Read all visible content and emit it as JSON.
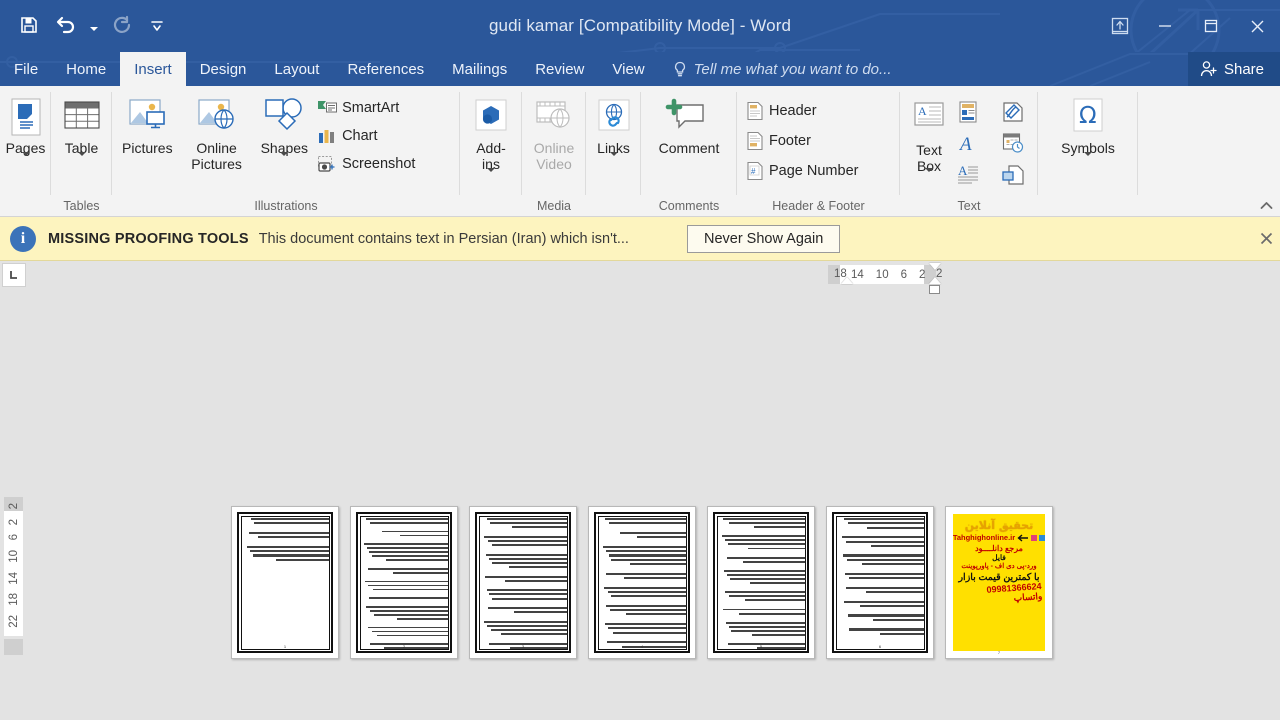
{
  "window": {
    "title": "gudi kamar [Compatibility Mode] - Word",
    "quick_access": [
      {
        "name": "save-button",
        "label": "Save",
        "icon": "save-icon",
        "enabled": true
      },
      {
        "name": "undo-button",
        "label": "Undo",
        "icon": "undo-icon",
        "enabled": true,
        "has_dropdown": true
      },
      {
        "name": "redo-button",
        "label": "Redo",
        "icon": "redo-icon",
        "enabled": false
      },
      {
        "name": "customize-quick-access-toolbar",
        "label": "Customize Quick Access Toolbar",
        "icon": "chevron-down-icon",
        "enabled": true
      }
    ],
    "controls": [
      {
        "name": "ribbon-display-options",
        "label": "Ribbon Display Options",
        "icon": "ribbon-display-icon"
      },
      {
        "name": "minimize-button",
        "label": "Minimize",
        "icon": "minimize-icon"
      },
      {
        "name": "restore-button",
        "label": "Restore Down",
        "icon": "restore-icon"
      },
      {
        "name": "close-button",
        "label": "Close",
        "icon": "close-icon"
      }
    ],
    "accent_color": "#2b579a",
    "tab_active_bg": "#f3f3f3"
  },
  "tabs": [
    {
      "label": "File",
      "active": false
    },
    {
      "label": "Home",
      "active": false
    },
    {
      "label": "Insert",
      "active": true
    },
    {
      "label": "Design",
      "active": false
    },
    {
      "label": "Layout",
      "active": false
    },
    {
      "label": "References",
      "active": false
    },
    {
      "label": "Mailings",
      "active": false
    },
    {
      "label": "Review",
      "active": false
    },
    {
      "label": "View",
      "active": false
    }
  ],
  "tellme": {
    "label": "Tell me what you want to do...",
    "icon": "lightbulb-icon"
  },
  "share": {
    "label": "Share",
    "icon": "share-person-icon"
  },
  "ribbon": {
    "collapse": {
      "name": "collapse-ribbon-button",
      "icon": "chevron-up-icon"
    },
    "groups": [
      {
        "label": "",
        "name": "pages-group",
        "big": [
          {
            "label": "Pages",
            "icon": "pages-icon",
            "dropdown": true,
            "enabled": true
          }
        ]
      },
      {
        "label": "Tables",
        "name": "tables-group",
        "big": [
          {
            "label": "Table",
            "icon": "table-icon",
            "dropdown": true,
            "enabled": true
          }
        ]
      },
      {
        "label": "Illustrations",
        "name": "illustrations-group",
        "big": [
          {
            "label": "Pictures",
            "icon": "pictures-icon",
            "dropdown": false,
            "enabled": true
          },
          {
            "label": "Online Pictures",
            "icon": "online-pictures-icon",
            "dropdown": false,
            "enabled": true
          },
          {
            "label": "Shapes",
            "icon": "shapes-icon",
            "dropdown": true,
            "enabled": true
          }
        ],
        "small": [
          {
            "label": "SmartArt",
            "icon": "smartart-icon",
            "dropdown": false
          },
          {
            "label": "Chart",
            "icon": "chart-icon",
            "dropdown": false
          },
          {
            "label": "Screenshot",
            "icon": "screenshot-icon",
            "dropdown": true
          }
        ]
      },
      {
        "label": "",
        "name": "addins-group",
        "big": [
          {
            "label": "Add-ins",
            "icon": "addins-icon",
            "dropdown": true,
            "enabled": true
          }
        ]
      },
      {
        "label": "Media",
        "name": "media-group",
        "big": [
          {
            "label": "Online Video",
            "icon": "online-video-icon",
            "dropdown": false,
            "enabled": false
          }
        ]
      },
      {
        "label": "",
        "name": "links-group",
        "big": [
          {
            "label": "Links",
            "icon": "links-icon",
            "dropdown": true,
            "enabled": true
          }
        ]
      },
      {
        "label": "Comments",
        "name": "comments-group",
        "big": [
          {
            "label": "Comment",
            "icon": "comment-icon",
            "dropdown": false,
            "enabled": true
          }
        ]
      },
      {
        "label": "Header & Footer",
        "name": "header-footer-group",
        "small": [
          {
            "label": "Header",
            "icon": "header-icon",
            "dropdown": true
          },
          {
            "label": "Footer",
            "icon": "footer-icon",
            "dropdown": true
          },
          {
            "label": "Page Number",
            "icon": "page-number-icon",
            "dropdown": true
          }
        ]
      },
      {
        "label": "Text",
        "name": "text-group",
        "big": [
          {
            "label": "Text Box",
            "icon": "text-box-icon",
            "dropdown": true,
            "enabled": true
          }
        ],
        "mini": [
          {
            "name": "quick-parts-icon",
            "dropdown": true
          },
          {
            "name": "signature-line-icon",
            "dropdown": true
          },
          {
            "name": "wordart-icon",
            "dropdown": true
          },
          {
            "name": "date-time-icon",
            "dropdown": false
          },
          {
            "name": "drop-cap-icon",
            "dropdown": true
          },
          {
            "name": "object-icon",
            "dropdown": true
          }
        ]
      },
      {
        "label": "",
        "name": "symbols-group",
        "big": [
          {
            "label": "Symbols",
            "icon": "omega-icon",
            "dropdown": true,
            "enabled": true
          }
        ]
      }
    ]
  },
  "notification": {
    "icon": "info-icon",
    "title": "MISSING PROOFING TOOLS",
    "message": "This document contains text in Persian (Iran) which isn't...",
    "button_label": "Never Show Again",
    "close_icon": "close-icon",
    "background": "#fdf4bf"
  },
  "rulers": {
    "corner_icon": "tab-stop-left-icon",
    "horizontal_numbers": [
      "18",
      "14",
      "10",
      "6",
      "2",
      "2"
    ],
    "vertical_numbers": [
      "2",
      "2",
      "6",
      "10",
      "14",
      "18",
      "22"
    ]
  },
  "document": {
    "background": "#e3e3e3",
    "pages": [
      {
        "number": 1,
        "type": "text",
        "lines": [
          14,
          13,
          13,
          0,
          14,
          13,
          13,
          12,
          0,
          13,
          14,
          13,
          13,
          12,
          11,
          8
        ]
      },
      {
        "number": 2,
        "type": "text",
        "lines": [
          14,
          13,
          0,
          13,
          12,
          10,
          0,
          13,
          14,
          13,
          13,
          12,
          0,
          12,
          13,
          11,
          0,
          13,
          13,
          12,
          11,
          0,
          13,
          14,
          13,
          12,
          0,
          13,
          12,
          11,
          0,
          12,
          13,
          13,
          10
        ]
      },
      {
        "number": 3,
        "type": "text",
        "lines": [
          13,
          14,
          13,
          12,
          11,
          0,
          13,
          13,
          12,
          0,
          14,
          13,
          13,
          12,
          11,
          10,
          0,
          13,
          12,
          0,
          13,
          14,
          13,
          12,
          11,
          0,
          12,
          13,
          11,
          0,
          13,
          13,
          12,
          10
        ]
      },
      {
        "number": 4,
        "type": "text",
        "lines": [
          13,
          12,
          0,
          13,
          12,
          11,
          0,
          14,
          13,
          13,
          12,
          11,
          10,
          0,
          13,
          12,
          11,
          0,
          13,
          14,
          13,
          12,
          0,
          13,
          12,
          11,
          10,
          0,
          12,
          13,
          12,
          11,
          0,
          13,
          12
        ]
      },
      {
        "number": 5,
        "type": "text",
        "lines": [
          14,
          13,
          12,
          0,
          13,
          14,
          13,
          12,
          11,
          0,
          13,
          12,
          0,
          13,
          13,
          12,
          11,
          10,
          0,
          14,
          13,
          12,
          0,
          13,
          12,
          11,
          0,
          13,
          13,
          12,
          11,
          10,
          0,
          12,
          11
        ]
      },
      {
        "number": 6,
        "type": "text",
        "lines": [
          13,
          12,
          11,
          0,
          13,
          14,
          12,
          0,
          13,
          12,
          11,
          10,
          0,
          13,
          13,
          12,
          0,
          12,
          11,
          0,
          13,
          12,
          11,
          0,
          13,
          12,
          0,
          12,
          11,
          10,
          0,
          11,
          9
        ]
      },
      {
        "number": 7,
        "type": "advertisement",
        "ad": {
          "background": "#ffe000",
          "title": "تحقیق آنلاین",
          "url": "Tahghighonline.ir",
          "line1": "مرجع دانلــــود",
          "line2": "فایل",
          "line3": "ورد-پی دی اف - پاورپوینت",
          "line4": "با کمترین قیمت بازار",
          "phone": "09981366624 واتساپ"
        }
      }
    ]
  }
}
